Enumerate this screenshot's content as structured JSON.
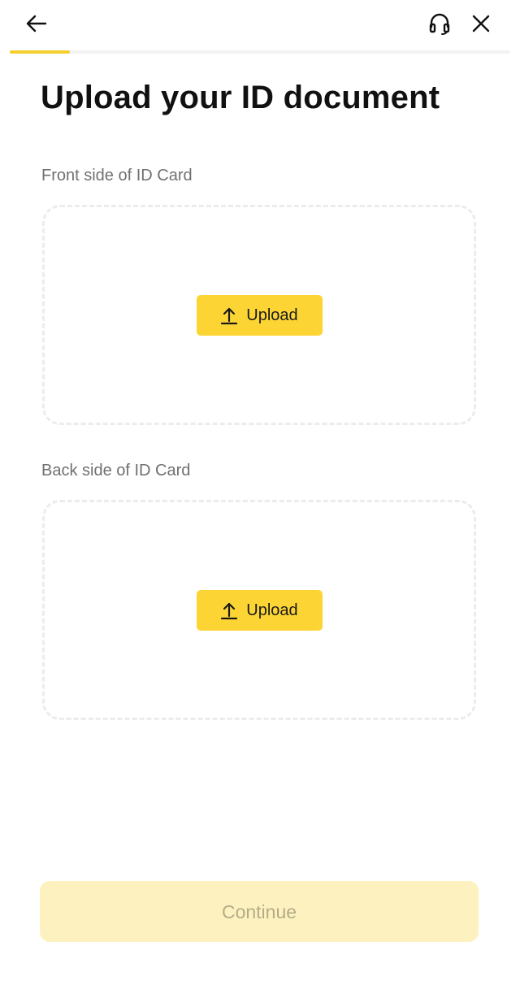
{
  "header": {
    "back_icon": "arrow-left-icon",
    "support_icon": "headset-icon",
    "close_icon": "close-icon"
  },
  "progress": {
    "value": 0.12,
    "color": "#f5cf2f"
  },
  "title": "Upload your ID document",
  "sections": {
    "front": {
      "label": "Front side of ID Card",
      "button_label": "Upload",
      "button_icon": "upload-icon"
    },
    "back": {
      "label": "Back side of ID Card",
      "button_label": "Upload",
      "button_icon": "upload-icon"
    }
  },
  "footer": {
    "continue_label": "Continue"
  },
  "colors": {
    "accent": "#fcd535",
    "accent_disabled": "#fdf2bf",
    "label_gray": "#707070"
  }
}
